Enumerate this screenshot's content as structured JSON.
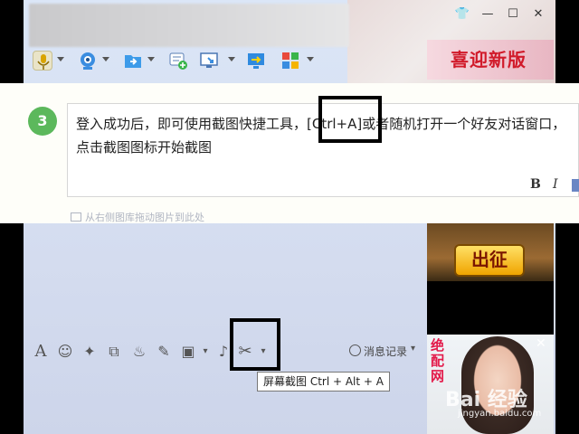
{
  "window": {
    "controls": {
      "skin": "👕",
      "minimize": "—",
      "maximize": "☐",
      "close": "✕"
    }
  },
  "top_toolbar": {
    "icons": [
      "microphone-icon",
      "webcam-icon",
      "file-transfer-icon",
      "add-contact-icon",
      "remote-desktop-icon",
      "share-screen-icon",
      "apps-grid-icon"
    ]
  },
  "side_ads": {
    "banner_text": "喜迎新版",
    "game_button": "出征",
    "photo_ad_text": "绝配网"
  },
  "instruction": {
    "step_number": "3",
    "text": "登入成功后，即可使用截图快捷工具，[Ctrl+A]或者随机打开一个好友对话窗口，点击截图图标开始截图",
    "format_bold": "B",
    "format_italic": "I"
  },
  "chat": {
    "drop_hint": "从右侧图库拖动图片到此处",
    "history_label": "消息记录",
    "tooltip": "屏幕截图 Ctrl + Alt + A"
  },
  "watermark": {
    "brand": "Bai 经验",
    "url": "jingyan.baidu.com"
  },
  "colors": {
    "step_badge": "#5cb85c",
    "highlight_box": "#000000"
  }
}
